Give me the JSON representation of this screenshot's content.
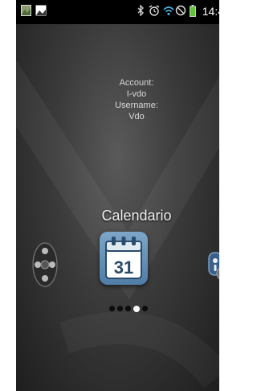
{
  "status_bar": {
    "time": "14:4",
    "icons": [
      "image-icon",
      "landscape-photo-icon",
      "bluetooth-icon",
      "alarm-icon",
      "wifi-icon",
      "no-sim-icon",
      "battery-icon"
    ]
  },
  "account": {
    "account_label": "Account:",
    "account_value": "I-vdo",
    "username_label": "Username:",
    "username_value": "Vdo"
  },
  "app": {
    "title": "Calendario",
    "calendar_day": "31"
  },
  "side_icons": {
    "left": "gamepad-remote-icon",
    "right": "remote-control-icon"
  },
  "pager": {
    "count": 5,
    "active_index": 3
  },
  "colors": {
    "background": "#3a3a3a",
    "calendar_blue": "#4f7da6",
    "battery_green": "#62c23a"
  }
}
